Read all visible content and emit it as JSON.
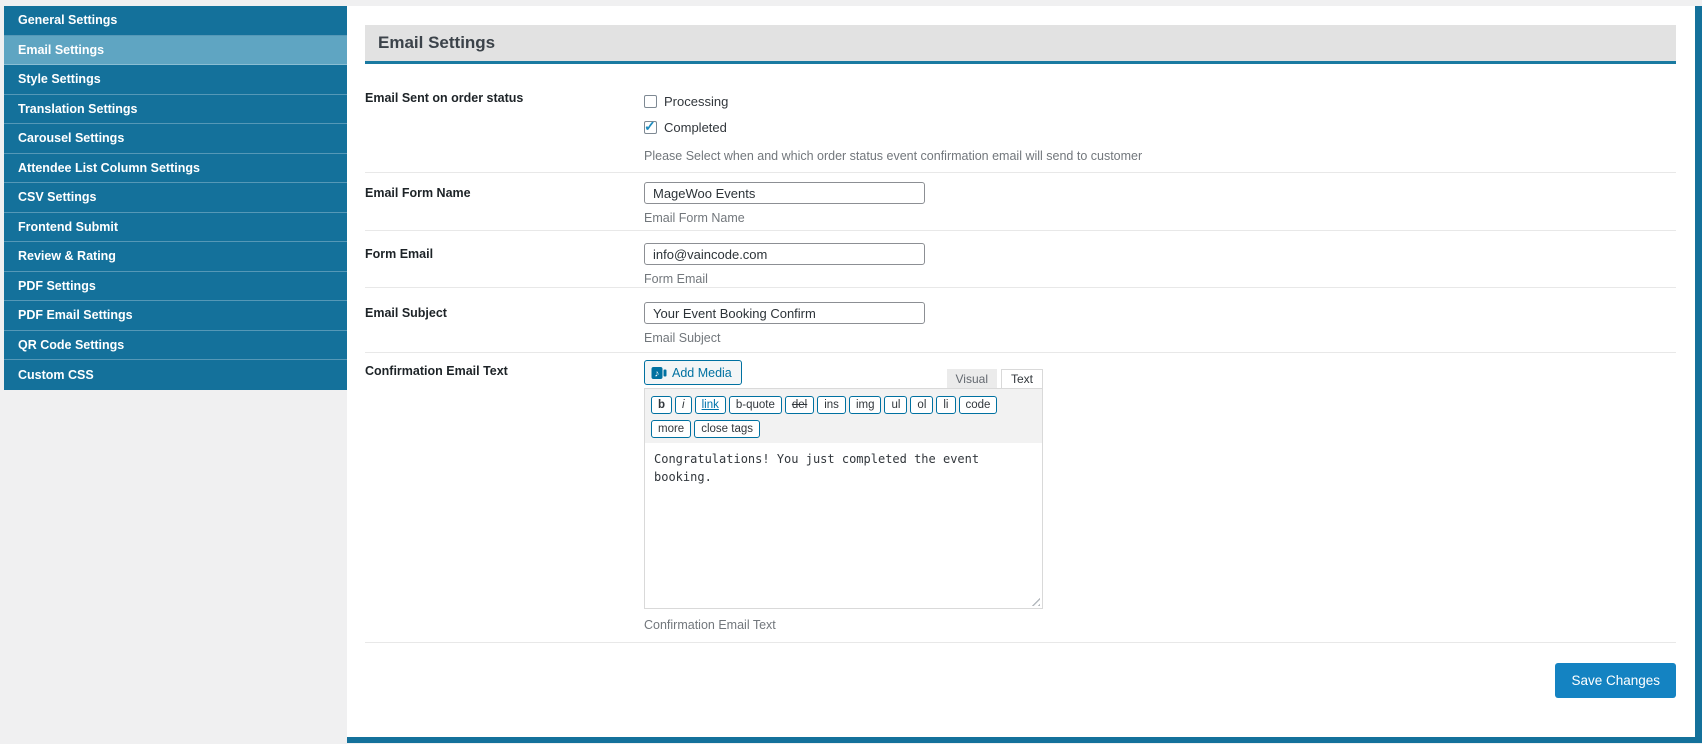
{
  "colors": {
    "accent_teal": "#14719b",
    "sidebar_active": "#5fa5c2",
    "header_bar_bg": "#e2e2e2",
    "header_border": "#1a7aa1",
    "save_button": "#1483c2",
    "quicktag_border": "#0071a1",
    "checkbox_check": "#1e8cbe"
  },
  "icons": {
    "checkmark": "✓"
  },
  "sidebar": {
    "items": [
      {
        "label": "General Settings",
        "active": false
      },
      {
        "label": "Email Settings",
        "active": true
      },
      {
        "label": "Style Settings",
        "active": false
      },
      {
        "label": "Translation Settings",
        "active": false
      },
      {
        "label": "Carousel Settings",
        "active": false
      },
      {
        "label": "Attendee List Column Settings",
        "active": false
      },
      {
        "label": "CSV Settings",
        "active": false
      },
      {
        "label": "Frontend Submit",
        "active": false
      },
      {
        "label": "Review & Rating",
        "active": false
      },
      {
        "label": "PDF Settings",
        "active": false
      },
      {
        "label": "PDF Email Settings",
        "active": false
      },
      {
        "label": "QR Code Settings",
        "active": false
      },
      {
        "label": "Custom CSS",
        "active": false
      }
    ]
  },
  "header": {
    "title": "Email Settings"
  },
  "form": {
    "order_status": {
      "label": "Email Sent on order status",
      "options": [
        {
          "label": "Processing",
          "checked": false
        },
        {
          "label": "Completed",
          "checked": true
        }
      ],
      "help": "Please Select when and which order status event confirmation email will send to customer"
    },
    "email_form_name": {
      "label": "Email Form Name",
      "value": "MageWoo Events",
      "help": "Email Form Name"
    },
    "form_email": {
      "label": "Form Email",
      "value": "info@vaincode.com",
      "help": "Form Email"
    },
    "email_subject": {
      "label": "Email Subject",
      "value": "Your Event Booking Confirm",
      "help": "Email Subject"
    },
    "confirmation_email": {
      "label": "Confirmation Email Text",
      "content": "Congratulations! You just completed the event booking.",
      "help": "Confirmation Email Text"
    }
  },
  "editor": {
    "add_media_label": "Add Media",
    "tabs": [
      {
        "label": "Visual",
        "active": false
      },
      {
        "label": "Text",
        "active": true
      }
    ],
    "quicktags": [
      "b",
      "i",
      "link",
      "b-quote",
      "del",
      "ins",
      "img",
      "ul",
      "ol",
      "li",
      "code",
      "more"
    ],
    "close_tags": "close tags"
  },
  "save_button_label": "Save Changes"
}
